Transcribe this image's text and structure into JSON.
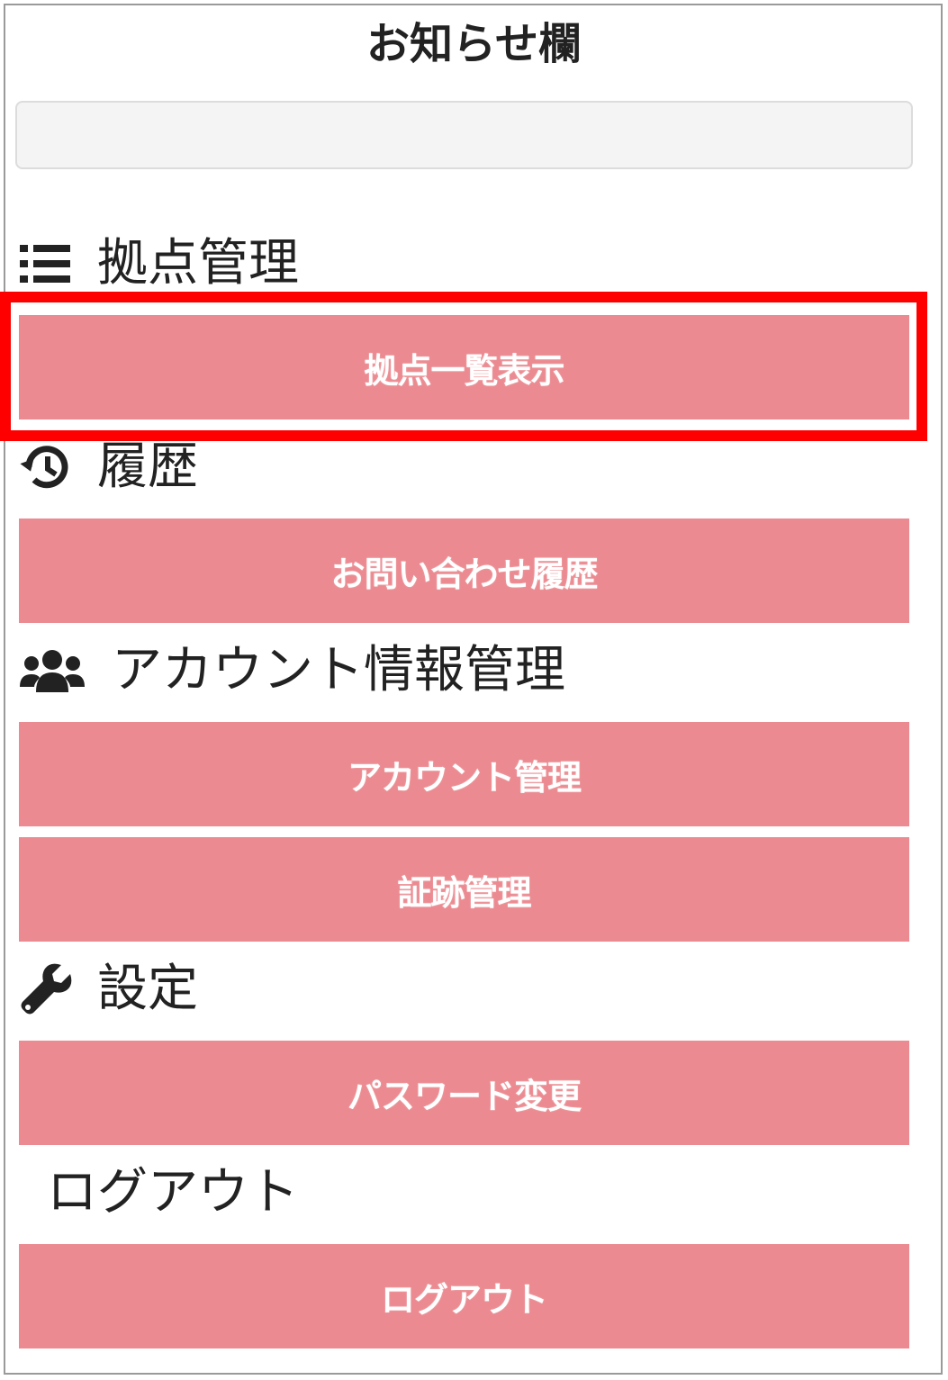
{
  "notice": {
    "title": "お知らせ欄",
    "content": ""
  },
  "sections": [
    {
      "heading": "拠点管理",
      "icon": "list-icon",
      "buttons": [
        "拠点一覧表示"
      ]
    },
    {
      "heading": "履歴",
      "icon": "history-icon",
      "buttons": [
        "お問い合わせ履歴"
      ]
    },
    {
      "heading": "アカウント情報管理",
      "icon": "users-icon",
      "buttons": [
        "アカウント管理",
        "証跡管理"
      ]
    },
    {
      "heading": "設定",
      "icon": "wrench-icon",
      "buttons": [
        "パスワード変更"
      ]
    },
    {
      "heading": "ログアウト",
      "icon": "",
      "buttons": [
        "ログアウト"
      ]
    }
  ],
  "colors": {
    "button_bg": "#eb8a90",
    "button_text": "#ffffff",
    "highlight": "#ff0000"
  }
}
